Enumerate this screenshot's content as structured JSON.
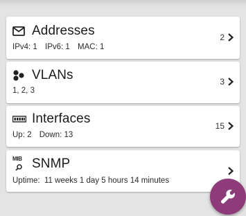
{
  "cards": [
    {
      "title": "Addresses",
      "icon": "envelope-icon",
      "details": [
        "IPv4: 1",
        "IPv6: 1",
        "MAC: 1"
      ],
      "count": "2"
    },
    {
      "title": "VLANs",
      "icon": "vlan-dots-icon",
      "details": [
        "1, 2, 3"
      ],
      "count": "3"
    },
    {
      "title": "Interfaces",
      "icon": "interfaces-icon",
      "details": [
        "Up: 2",
        "Down: 13"
      ],
      "count": "15"
    },
    {
      "title": "SNMP",
      "icon": "mib-icon",
      "icon_text": "MIB",
      "details": [
        "Uptime:  11 weeks 1 day 5 hours 14 minutes"
      ],
      "count": ""
    }
  ],
  "fab": {
    "icon": "wrench-icon",
    "color": "#8e3c79"
  },
  "colors": {
    "background": "#e4e4e4",
    "card": "#ffffff",
    "accent": "#8e3c79"
  }
}
